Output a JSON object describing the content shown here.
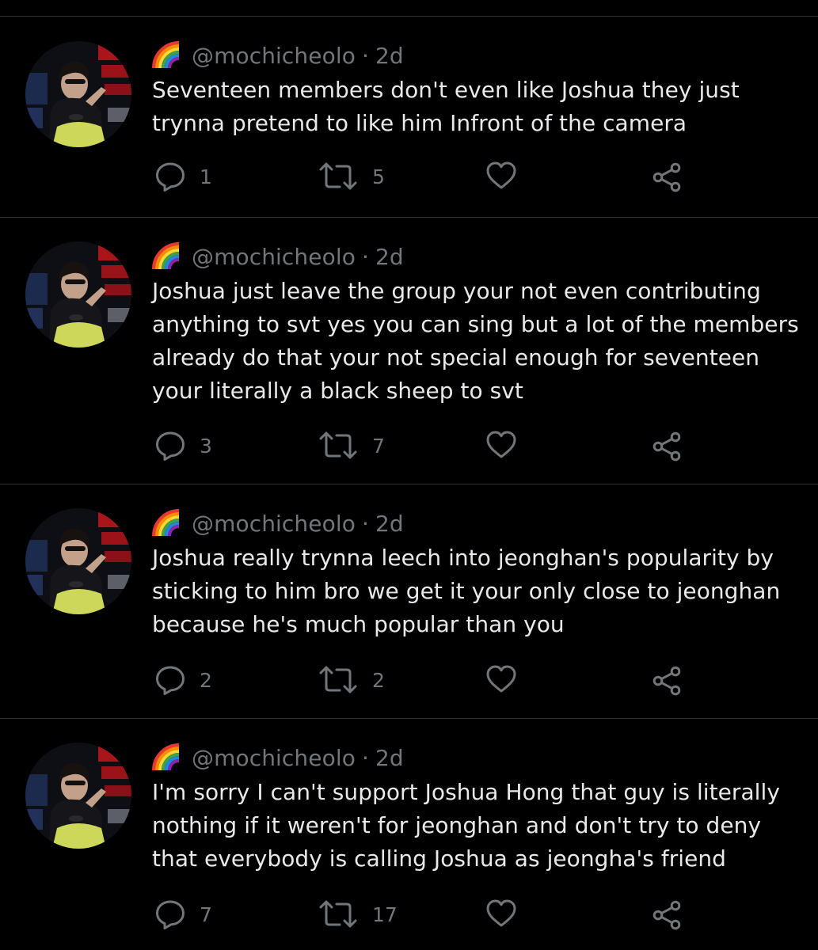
{
  "colors": {
    "background": "#000000",
    "text": "#e7e9ea",
    "muted": "#71767b",
    "divider": "#2f3336"
  },
  "tweets": [
    {
      "emoji_icon": "rainbow-icon",
      "handle": "@mochicheolo",
      "separator": "·",
      "time": "2d",
      "text": "Seventeen members don't even like Joshua they just\ntrynna pretend to like him Infront of the camera",
      "reply_count": "1",
      "retweet_count": "5",
      "like_count": ""
    },
    {
      "emoji_icon": "rainbow-icon",
      "handle": "@mochicheolo",
      "separator": "·",
      "time": "2d",
      "text": "Joshua just leave the group your not even contributing\nanything to svt yes you can sing but a lot of the members\nalready do that your not special enough for seventeen\nyour literally a black sheep to svt",
      "reply_count": "3",
      "retweet_count": "7",
      "like_count": ""
    },
    {
      "emoji_icon": "rainbow-icon",
      "handle": "@mochicheolo",
      "separator": "·",
      "time": "2d",
      "text": "Joshua really trynna leech into jeonghan's popularity by\nsticking to him bro we get it your only close to jeonghan\nbecause he's much popular than you",
      "reply_count": "2",
      "retweet_count": "2",
      "like_count": ""
    },
    {
      "emoji_icon": "rainbow-icon",
      "handle": "@mochicheolo",
      "separator": "·",
      "time": "2d",
      "text": "I'm sorry I can't support Joshua Hong that guy is literally\nnothing if it weren't for jeonghan and don't try to deny\nthat everybody is calling Joshua as jeongha's friend",
      "reply_count": "7",
      "retweet_count": "17",
      "like_count": ""
    }
  ]
}
